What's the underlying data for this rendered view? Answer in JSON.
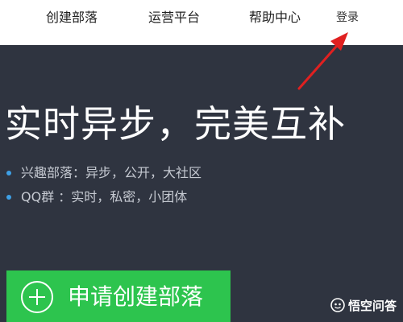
{
  "nav": {
    "create_tribe": "创建部落",
    "ops_platform": "运营平台",
    "help_center": "帮助中心",
    "login": "登录"
  },
  "hero": {
    "headline": "实时异步，完美互补",
    "bullets": [
      {
        "text": "兴趣部落：异步，公开，大社区"
      },
      {
        "text": "QQ群   ：实时，私密，小团体"
      }
    ],
    "cta_label": "申请创建部落"
  },
  "watermark": {
    "text": "悟空问答"
  },
  "annotation": {
    "icon": "red-arrow-pointing-login"
  },
  "colors": {
    "hero_bg": "#2f3440",
    "cta_green": "#2dc44e",
    "bullet_blue": "#3ea0e6",
    "arrow_red": "#e02020"
  }
}
